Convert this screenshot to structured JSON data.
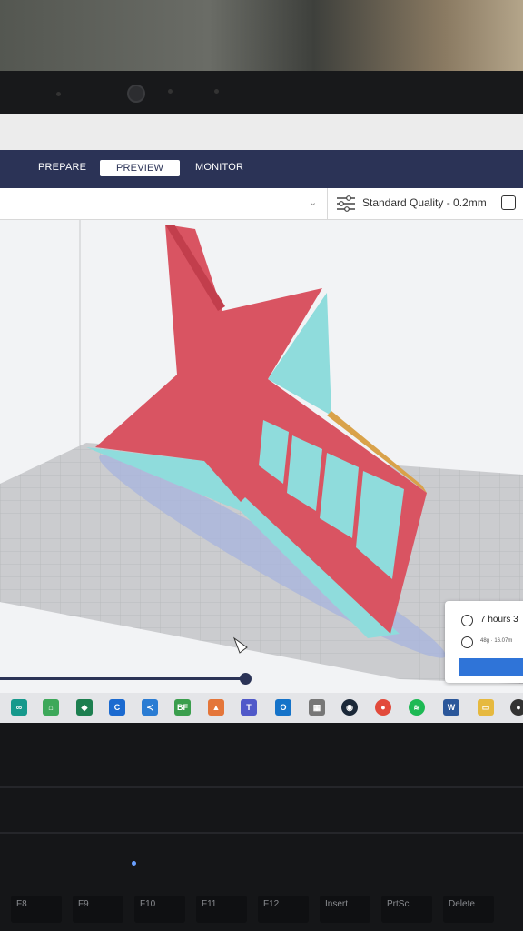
{
  "tabs": {
    "prepare": "PREPARE",
    "preview": "PREVIEW",
    "monitor": "MONITOR"
  },
  "toolbar": {
    "quality": "Standard Quality - 0.2mm"
  },
  "print_info": {
    "time": "7 hours 3",
    "material": "48g · 16.07m"
  },
  "layer_slider": {
    "progress": 0.47
  },
  "keyboard_keys": [
    "F8",
    "F9",
    "F10",
    "F11",
    "F12",
    "Insert",
    "PrtSc",
    "Delete"
  ],
  "taskbar_icons": [
    "onenote-icon",
    "maps-icon",
    "app-icon",
    "cura-icon",
    "vscode-icon",
    "bf-icon",
    "matlab-icon",
    "teams-icon",
    "outlook-icon",
    "calculator-icon",
    "steam-icon",
    "chrome-icon",
    "spotify-icon",
    "word-icon",
    "explorer-icon",
    "obs-icon"
  ],
  "colors": {
    "navbar": "#2b3356",
    "wall_red": "#d95462",
    "support_cyan": "#8fdcdc",
    "build_plate": "#c8c9cc",
    "action_blue": "#2f74d8"
  }
}
